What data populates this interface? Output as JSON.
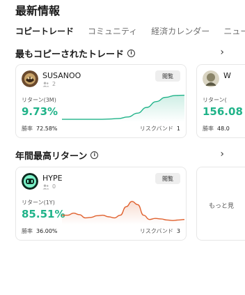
{
  "page": {
    "title": "最新情報"
  },
  "tabs": [
    {
      "label": "コピートレード",
      "active": true
    },
    {
      "label": "コミュニティ",
      "active": false
    },
    {
      "label": "経済カレンダー",
      "active": false
    },
    {
      "label": "ニュー",
      "active": false
    }
  ],
  "sections": {
    "most_copied": {
      "title": "最もコピーされたトレード",
      "cards": [
        {
          "name": "SUSANOO",
          "followers": "2",
          "view_label": "閲覧",
          "return_label": "リターン(3M)",
          "return_value": "9.73%",
          "winrate_label": "勝率",
          "winrate_value": "72.58%",
          "risk_label": "リスクバンド",
          "risk_value": "1",
          "chart_color": "#20b389",
          "chart_values": [
            0.05,
            0.05,
            0.05,
            0.05,
            0.05,
            0.06,
            0.08,
            0.14,
            0.28,
            0.5,
            0.72,
            0.88,
            0.95,
            0.96
          ]
        }
      ],
      "peek": {
        "name": "W",
        "return_label": "リターン(",
        "return_value": "156.08",
        "winrate_label": "勝率",
        "winrate_value": "48.0"
      }
    },
    "annual_top": {
      "title": "年間最高リターン",
      "cards": [
        {
          "name": "HYPE",
          "followers": "0",
          "view_label": "閲覧",
          "return_label": "リターン(1Y)",
          "return_value": "85.51%",
          "winrate_label": "勝率",
          "winrate_value": "36.00%",
          "risk_label": "リスクバンド",
          "risk_value": "3",
          "chart_color": "#e0612e",
          "chart_values": [
            0.3,
            0.3,
            0.38,
            0.32,
            0.2,
            0.22,
            0.28,
            0.3,
            0.24,
            0.2,
            0.3,
            0.62,
            0.82,
            0.7,
            0.3,
            0.14,
            0.18,
            0.16,
            0.12,
            0.1,
            0.12,
            0.14
          ]
        }
      ],
      "peek": {
        "more_label": "もっと見"
      }
    }
  },
  "icons": {
    "info": "info-icon",
    "chevron": "chevron-right-icon",
    "followers": "people-icon"
  },
  "colors": {
    "positive": "#20b389",
    "accent_orange": "#e0612e"
  }
}
